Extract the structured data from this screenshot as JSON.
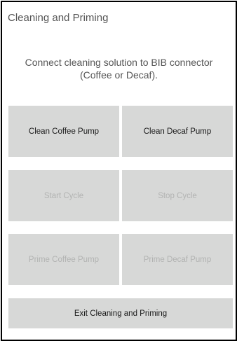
{
  "screen": {
    "title": "Cleaning and Priming",
    "instruction_line1": "Connect cleaning solution to BIB connector",
    "instruction_line2": "(Coffee or Decaf)."
  },
  "buttons": {
    "clean_coffee_pump": {
      "label": "Clean Coffee Pump",
      "enabled": true
    },
    "clean_decaf_pump": {
      "label": "Clean Decaf Pump",
      "enabled": true
    },
    "start_cycle": {
      "label": "Start Cycle",
      "enabled": false
    },
    "stop_cycle": {
      "label": "Stop Cycle",
      "enabled": false
    },
    "prime_coffee_pump": {
      "label": "Prime Coffee Pump",
      "enabled": false
    },
    "prime_decaf_pump": {
      "label": "Prime Decaf Pump",
      "enabled": false
    },
    "exit": {
      "label": "Exit Cleaning and Priming",
      "enabled": true
    }
  },
  "colors": {
    "button_background": "#d7d8d7",
    "enabled_text": "#1a1a1a",
    "disabled_text": "#b2b3b2",
    "heading_text": "#555555",
    "frame_border": "#000000"
  }
}
